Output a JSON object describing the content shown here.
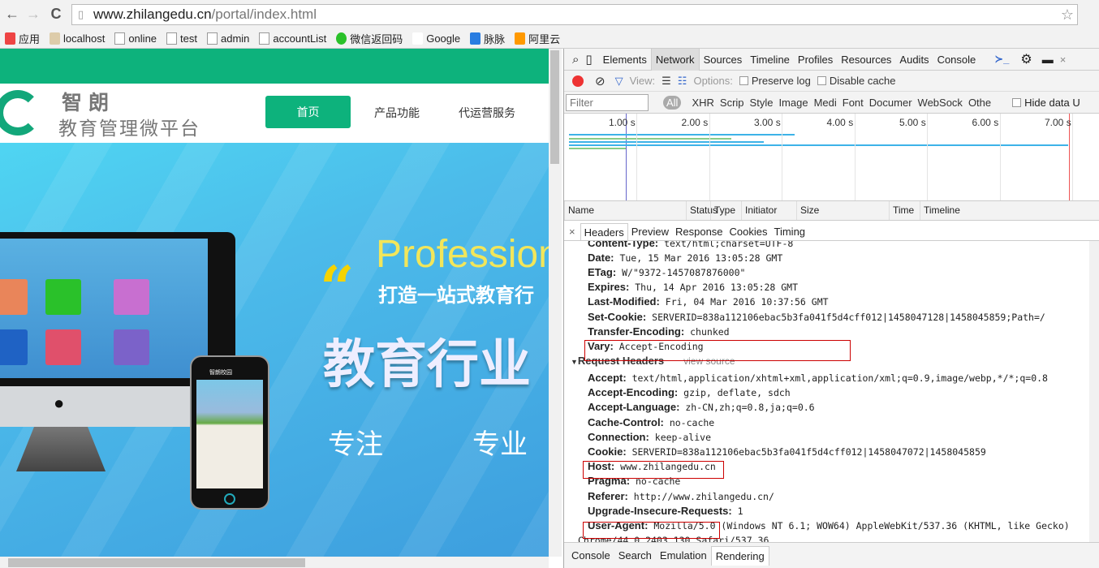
{
  "browser": {
    "url_host": "www.zhilangedu.cn",
    "url_path": "/portal/index.html",
    "bookmarks": [
      {
        "label": "应用",
        "icon": "apps-grid-icon"
      },
      {
        "label": "localhost",
        "icon": "tomcat-icon"
      },
      {
        "label": "online",
        "icon": "page-icon"
      },
      {
        "label": "test",
        "icon": "page-icon"
      },
      {
        "label": "admin",
        "icon": "page-icon"
      },
      {
        "label": "accountList",
        "icon": "page-icon"
      },
      {
        "label": "微信返回码",
        "icon": "wechat-icon"
      },
      {
        "label": "Google",
        "icon": "google-icon"
      },
      {
        "label": "脉脉",
        "icon": "maimai-icon"
      },
      {
        "label": "阿里云",
        "icon": "aliyun-icon"
      }
    ]
  },
  "site": {
    "brand_name": "智朗",
    "brand_sub": "教育管理微平台",
    "nav": [
      "首页",
      "产品功能",
      "代运营服务"
    ],
    "brand_color": "#0db27c",
    "hero": {
      "headline_en": "Profession",
      "slogan": "打造一站式教育行",
      "big": "教育行业",
      "word1": "专注",
      "word2": "专业",
      "phone_title": "智朗校园"
    }
  },
  "devtools": {
    "tabs": [
      "Elements",
      "Network",
      "Sources",
      "Timeline",
      "Profiles",
      "Resources",
      "Audits",
      "Console"
    ],
    "active_tab": "Network",
    "toolbar": {
      "view": "View:",
      "options": "Options:",
      "preserve_log": "Preserve log",
      "disable_cache": "Disable cache"
    },
    "filter": {
      "placeholder": "Filter",
      "all": "All",
      "types": [
        "XHR",
        "Scrip",
        "Style",
        "Image",
        "Medi",
        "Font",
        "Documer",
        "WebSock",
        "Othe"
      ],
      "hide_data": "Hide data U"
    },
    "timeline_ticks": [
      "1.00 s",
      "2.00 s",
      "3.00 s",
      "4.00 s",
      "5.00 s",
      "6.00 s",
      "7.00 s"
    ],
    "columns": [
      "Name",
      "Status",
      "Type",
      "Initiator",
      "Size",
      "Time",
      "Timeline"
    ],
    "detail_tabs": [
      "Headers",
      "Preview",
      "Response",
      "Cookies",
      "Timing"
    ],
    "response_headers": [
      {
        "k": "Content-Type:",
        "v": "text/html;charset=UTF-8"
      },
      {
        "k": "Date:",
        "v": "Tue, 15 Mar 2016 13:05:28 GMT"
      },
      {
        "k": "ETag:",
        "v": "W/\"9372-1457087876000\""
      },
      {
        "k": "Expires:",
        "v": "Thu, 14 Apr 2016 13:05:28 GMT"
      },
      {
        "k": "Last-Modified:",
        "v": "Fri, 04 Mar 2016 10:37:56 GMT"
      },
      {
        "k": "Set-Cookie:",
        "v": "SERVERID=838a112106ebac5b3fa041f5d4cff012|1458047128|1458045859;Path=/"
      },
      {
        "k": "Transfer-Encoding:",
        "v": "chunked"
      },
      {
        "k": "Vary:",
        "v": "Accept-Encoding"
      }
    ],
    "request_title": "Request Headers",
    "view_source": "view source",
    "request_headers": [
      {
        "k": "Accept:",
        "v": "text/html,application/xhtml+xml,application/xml;q=0.9,image/webp,*/*;q=0.8"
      },
      {
        "k": "Accept-Encoding:",
        "v": "gzip, deflate, sdch"
      },
      {
        "k": "Accept-Language:",
        "v": "zh-CN,zh;q=0.8,ja;q=0.6"
      },
      {
        "k": "Cache-Control:",
        "v": "no-cache"
      },
      {
        "k": "Connection:",
        "v": "keep-alive"
      },
      {
        "k": "Cookie:",
        "v": "SERVERID=838a112106ebac5b3fa041f5d4cff012|1458047072|1458045859"
      },
      {
        "k": "Host:",
        "v": "www.zhilangedu.cn"
      },
      {
        "k": "Pragma:",
        "v": "no-cache"
      },
      {
        "k": "Referer:",
        "v": "http://www.zhilangedu.cn/"
      },
      {
        "k": "Upgrade-Insecure-Requests:",
        "v": "1"
      },
      {
        "k": "User-Agent:",
        "v": "Mozilla/5.0 (Windows NT 6.1; WOW64) AppleWebKit/537.36 (KHTML, like Gecko)"
      }
    ],
    "ua_cont": "Chrome/44.0.2403.130 Safari/537.36",
    "drawer_tabs": [
      "Console",
      "Search",
      "Emulation",
      "Rendering"
    ],
    "active_drawer": "Rendering"
  }
}
